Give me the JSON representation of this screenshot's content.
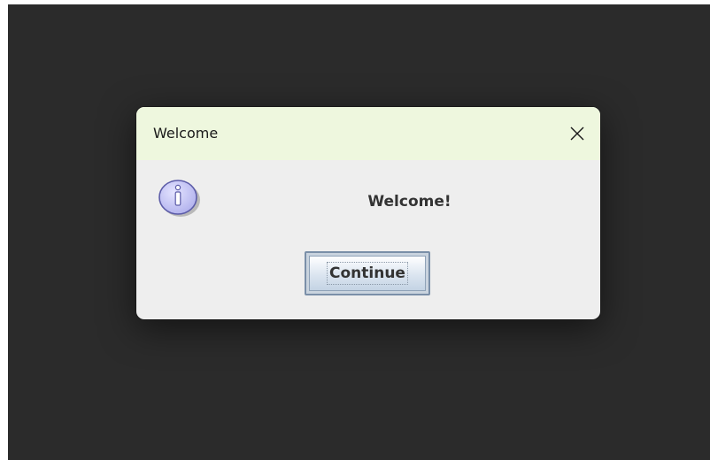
{
  "dialog": {
    "title": "Welcome",
    "message": "Welcome!",
    "continue_label": "Continue",
    "icon": "info-icon",
    "close_icon": "close-icon"
  },
  "colors": {
    "titlebar": "#eef7de",
    "dialog_body": "#eeeeee",
    "desktop": "#2b2b2b",
    "info_icon_fill": "#c8c8f4",
    "info_icon_stroke": "#5c5ca8"
  }
}
